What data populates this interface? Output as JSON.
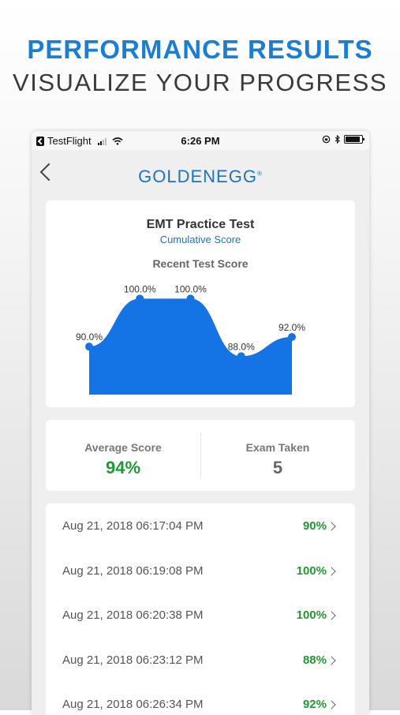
{
  "promo": {
    "headline": "PERFORMANCE RESULTS",
    "subheadline": "VISUALIZE YOUR PROGRESS"
  },
  "status_bar": {
    "app": "TestFlight",
    "time": "6:26 PM"
  },
  "nav": {
    "logo": "GOLDENEGG",
    "logo_mark": "®"
  },
  "chart_card": {
    "title": "EMT Practice Test",
    "subtitle": "Cumulative Score"
  },
  "chart_data": {
    "type": "area",
    "title": "Recent Test Score",
    "x": [
      1,
      2,
      3,
      4,
      5
    ],
    "values": [
      90.0,
      100.0,
      100.0,
      88.0,
      92.0
    ],
    "labels": [
      "90.0%",
      "100.0%",
      "100.0%",
      "88.0%",
      "92.0%"
    ],
    "ylim": [
      80,
      104
    ],
    "grid": false,
    "color": "#1474e6"
  },
  "stats": {
    "average_label": "Average Score",
    "average_value": "94%",
    "exams_label": "Exam Taken",
    "exams_value": "5"
  },
  "history": [
    {
      "date": "Aug 21, 2018 06:17:04 PM",
      "score": "90%"
    },
    {
      "date": "Aug 21, 2018 06:19:08 PM",
      "score": "100%"
    },
    {
      "date": "Aug 21, 2018 06:20:38 PM",
      "score": "100%"
    },
    {
      "date": "Aug 21, 2018 06:23:12 PM",
      "score": "88%"
    },
    {
      "date": "Aug 21, 2018 06:26:34 PM",
      "score": "92%"
    }
  ],
  "colors": {
    "accent": "#1b74c4",
    "good": "#1f9a2e",
    "neutral": "#666666"
  }
}
